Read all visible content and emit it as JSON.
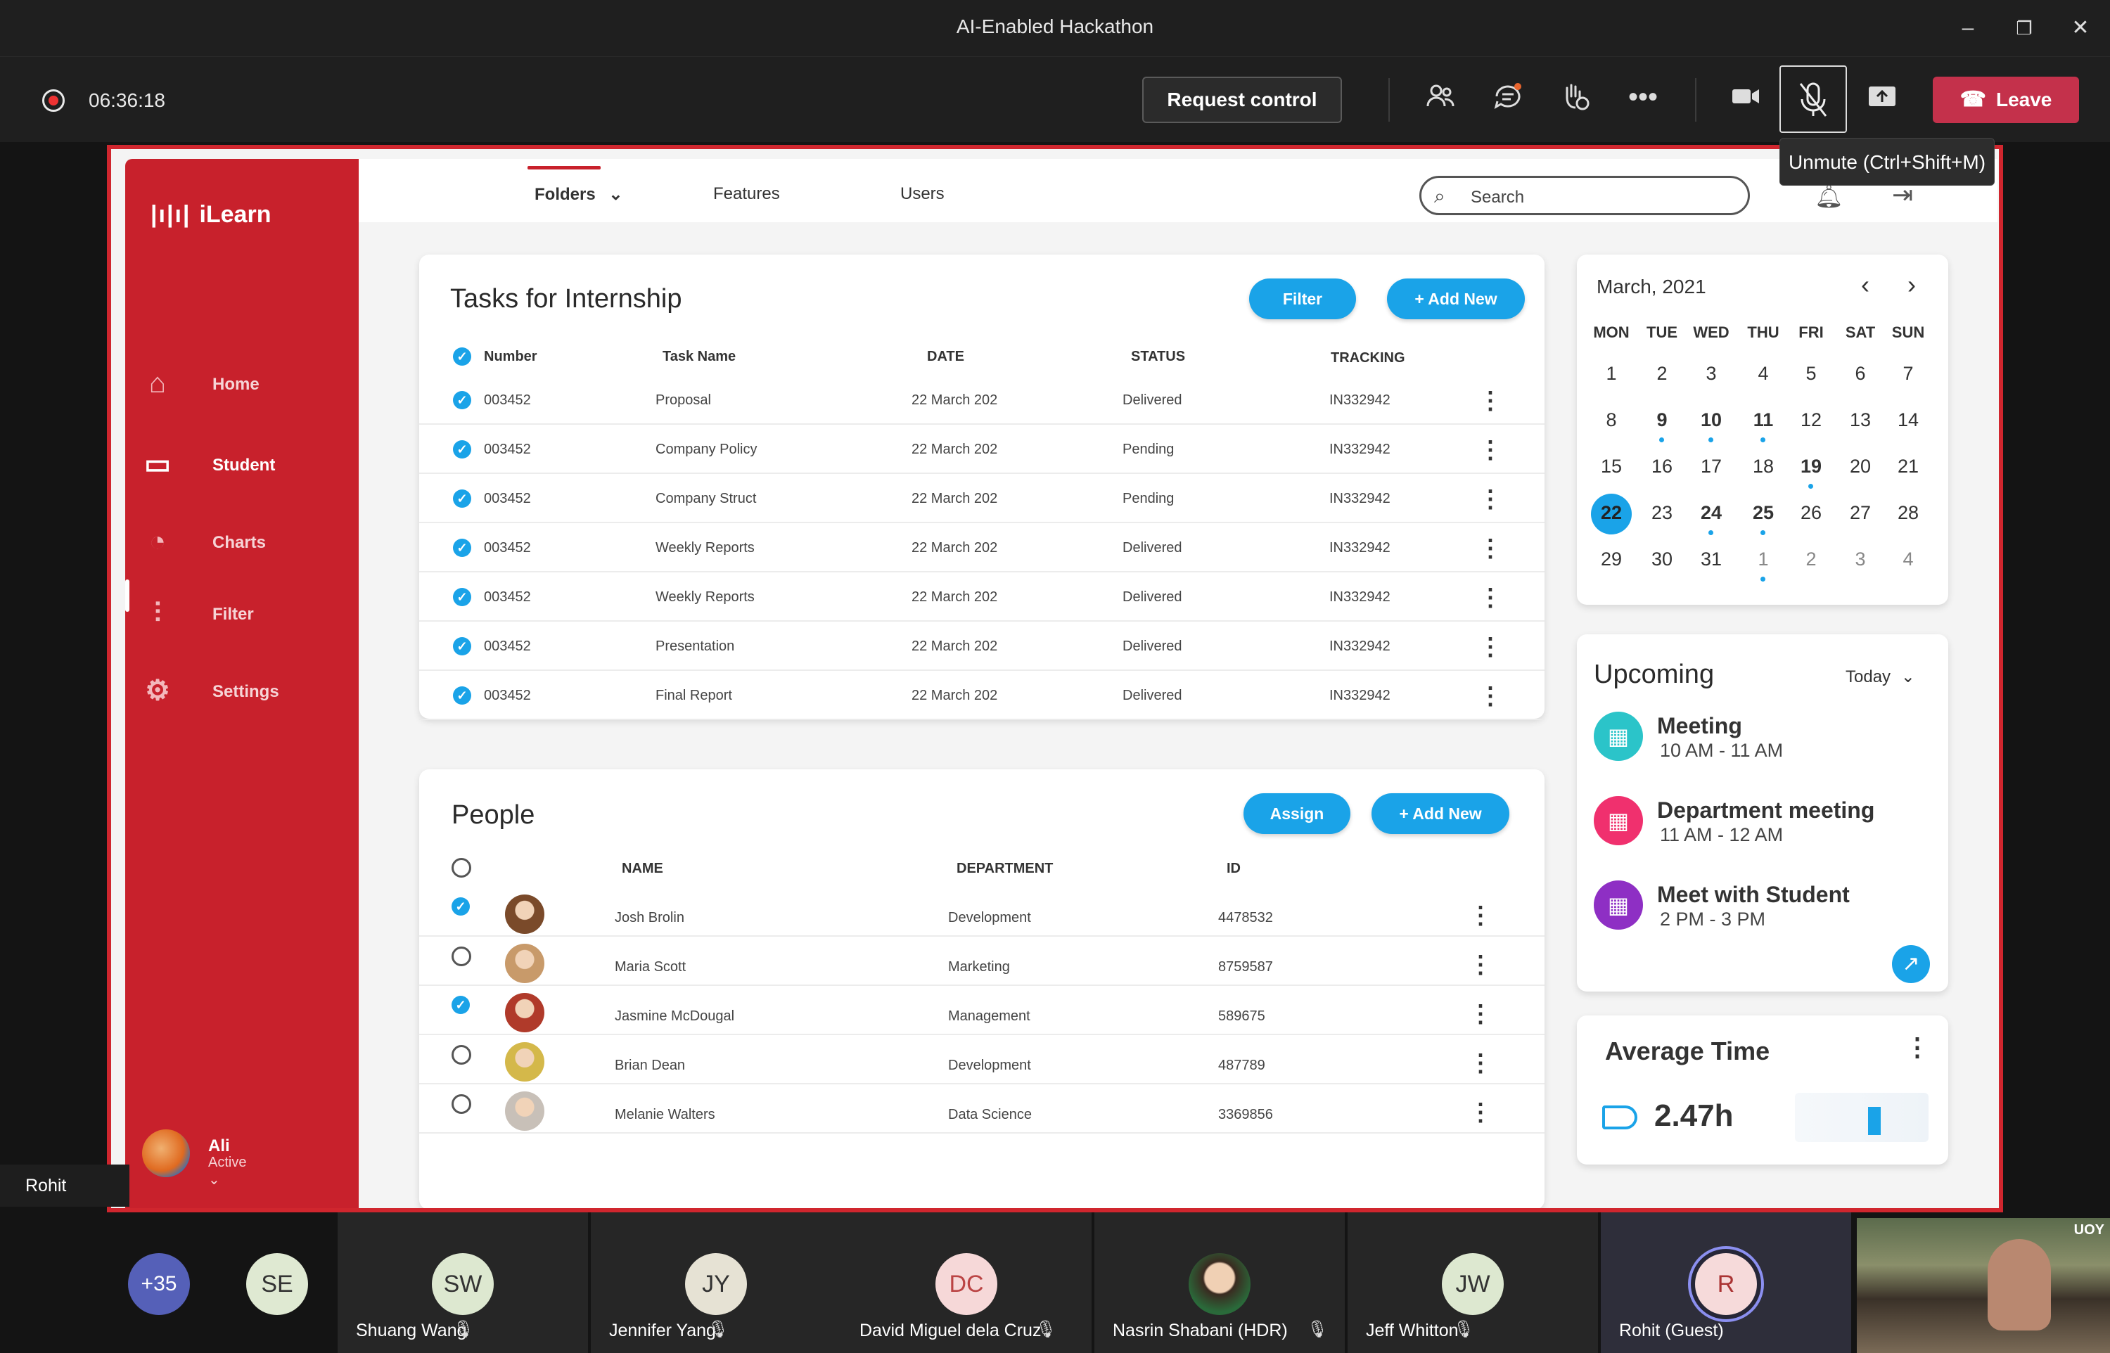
{
  "window": {
    "title": "AI-Enabled Hackathon"
  },
  "meeting": {
    "timer": "06:36:18",
    "request_control": "Request control",
    "leave": "Leave",
    "tooltip": "Unmute (Ctrl+Shift+M)",
    "presenter_label": "Rohit (Guest)"
  },
  "app": {
    "logo": "iLearn",
    "nav": [
      "Home",
      "Student",
      "Charts",
      "Filter",
      "Settings"
    ],
    "user": {
      "name": "Ali",
      "status": "Active"
    },
    "topnav": [
      "Folders",
      "Features",
      "Users"
    ],
    "search_placeholder": "Search"
  },
  "tasks": {
    "title": "Tasks for Internship",
    "filter": "Filter",
    "add_new": "+ Add New",
    "headers": [
      "Number",
      "Task Name",
      "DATE",
      "STATUS",
      "TRACKING"
    ],
    "rows": [
      {
        "number": "003452",
        "name": "Proposal",
        "date": "22 March 202",
        "status": "Delivered",
        "tracking": "IN332942"
      },
      {
        "number": "003452",
        "name": "Company Policy",
        "date": "22 March 202",
        "status": "Pending",
        "tracking": "IN332942"
      },
      {
        "number": "003452",
        "name": "Company Struct",
        "date": "22 March 202",
        "status": "Pending",
        "tracking": "IN332942"
      },
      {
        "number": "003452",
        "name": "Weekly Reports",
        "date": "22 March 202",
        "status": "Delivered",
        "tracking": "IN332942"
      },
      {
        "number": "003452",
        "name": "Weekly Reports",
        "date": "22 March 202",
        "status": "Delivered",
        "tracking": "IN332942"
      },
      {
        "number": "003452",
        "name": "Presentation",
        "date": "22 March 202",
        "status": "Delivered",
        "tracking": "IN332942"
      },
      {
        "number": "003452",
        "name": "Final Report",
        "date": "22 March 202",
        "status": "Delivered",
        "tracking": "IN332942"
      }
    ]
  },
  "people": {
    "title": "People",
    "assign": "Assign",
    "add_new": "+ Add New",
    "headers": [
      "NAME",
      "DEPARTMENT",
      "ID"
    ],
    "rows": [
      {
        "name": "Josh Brolin",
        "department": "Development",
        "id": "4478532",
        "checked": true
      },
      {
        "name": "Maria Scott",
        "department": "Marketing",
        "id": "8759587",
        "checked": false
      },
      {
        "name": "Jasmine McDougal",
        "department": "Management",
        "id": "589675",
        "checked": true
      },
      {
        "name": "Brian Dean",
        "department": "Development",
        "id": "487789",
        "checked": false
      },
      {
        "name": "Melanie Walters",
        "department": "Data Science",
        "id": "3369856",
        "checked": false
      }
    ]
  },
  "calendar": {
    "month": "March, 2021",
    "weekdays": [
      "MON",
      "TUE",
      "WED",
      "THU",
      "FRI",
      "SAT",
      "SUN"
    ],
    "weeks": [
      [
        "1",
        "2",
        "3",
        "4",
        "5",
        "6",
        "7"
      ],
      [
        "8",
        "9",
        "10",
        "11",
        "12",
        "13",
        "14"
      ],
      [
        "15",
        "16",
        "17",
        "18",
        "19",
        "20",
        "21"
      ],
      [
        "22",
        "23",
        "24",
        "25",
        "26",
        "27",
        "28"
      ],
      [
        "29",
        "30",
        "31",
        "1",
        "2",
        "3",
        "4"
      ]
    ],
    "selected": "22"
  },
  "upcoming": {
    "title": "Upcoming",
    "filter": "Today",
    "events": [
      {
        "title": "Meeting",
        "time": "10 AM - 11 AM",
        "color": "#2bc4c9"
      },
      {
        "title": "Department meeting",
        "time": "11 AM - 12 AM",
        "color": "#f0306e"
      },
      {
        "title": "Meet with Student",
        "time": "2 PM - 3 PM",
        "color": "#8e2fc4"
      }
    ]
  },
  "average_time": {
    "title": "Average Time",
    "value": "2.47h"
  },
  "participants": {
    "overflow": "+35",
    "list": [
      {
        "initials": "SE",
        "name": ""
      },
      {
        "initials": "SW",
        "name": "Shuang Wang"
      },
      {
        "initials": "JY",
        "name": "Jennifer Yang"
      },
      {
        "initials": "DC",
        "name": "David Miguel dela Cruz"
      },
      {
        "initials": "",
        "name": "Nasrin Shabani (HDR)"
      },
      {
        "initials": "JW",
        "name": "Jeff Whitton"
      },
      {
        "initials": "R",
        "name": "Rohit (Guest)"
      }
    ],
    "video_badge": "UOY"
  },
  "colors": {
    "brand": "#c8212c",
    "accent": "#1aa3e8",
    "leave": "#c4314b"
  }
}
